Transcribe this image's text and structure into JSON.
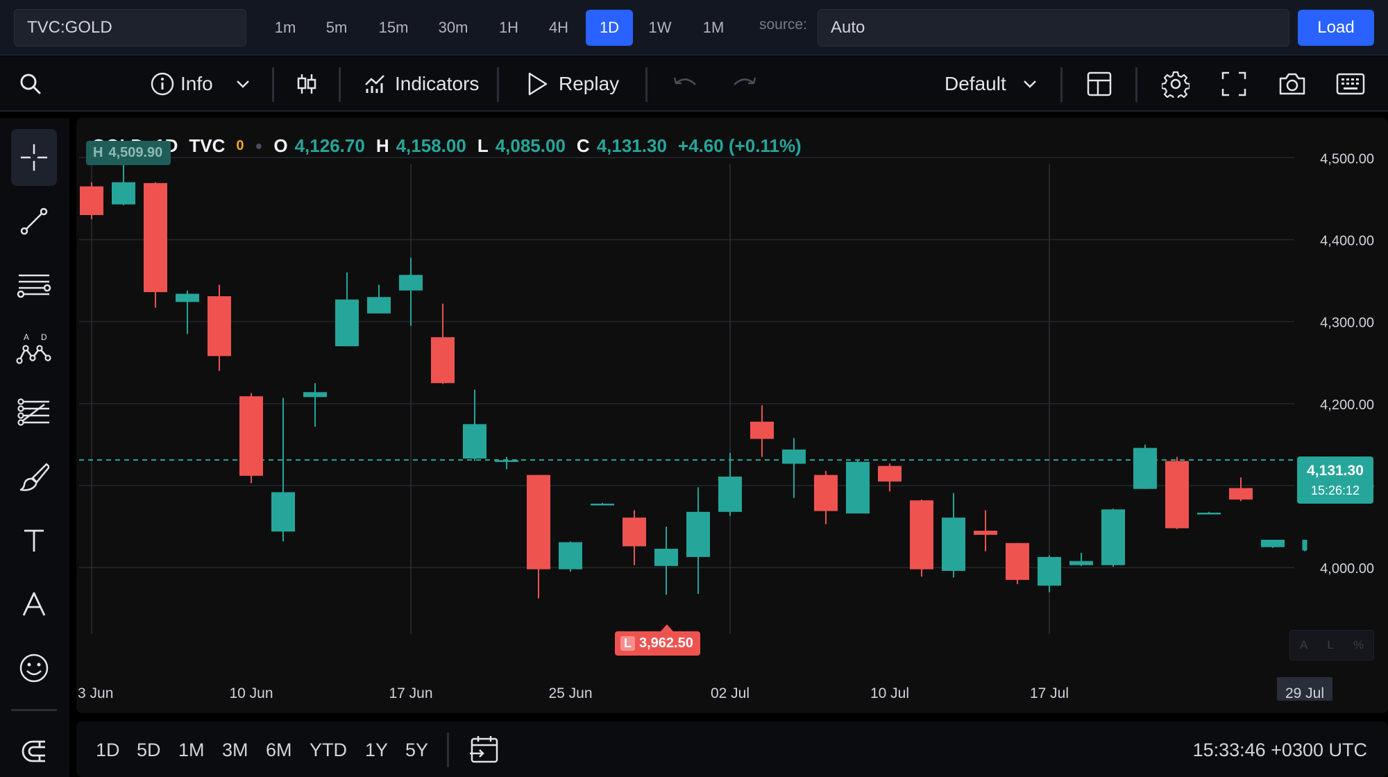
{
  "topbar": {
    "symbol": "TVC:GOLD",
    "timeframes": [
      "1m",
      "5m",
      "15m",
      "30m",
      "1H",
      "4H",
      "1D",
      "1W",
      "1M"
    ],
    "active_timeframe": "1D",
    "source_label": "source:",
    "source_value": "Auto",
    "load_label": "Load",
    "accent_color": "#2962ff"
  },
  "toolbar": {
    "info_label": "Info",
    "indicators_label": "Indicators",
    "replay_label": "Replay",
    "layout_label": "Default",
    "icons": [
      "search-icon",
      "info-icon",
      "chevron-down-icon",
      "candles-icon",
      "indicators-icon",
      "play-icon",
      "undo-icon",
      "redo-icon",
      "chevron-down-icon",
      "layout-icon",
      "gear-icon",
      "fullscreen-icon",
      "camera-icon",
      "keyboard-icon"
    ]
  },
  "left_toolbar": {
    "tools": [
      "crosshair-icon",
      "trend-line-icon",
      "horizontal-lines-icon",
      "pattern-icon",
      "fib-icon",
      "brush-icon",
      "text-icon",
      "font-icon",
      "emoji-icon",
      "magnet-icon"
    ],
    "pattern_letters": [
      "A",
      "D"
    ]
  },
  "legend": {
    "symbol": "GOLD",
    "interval": "1D",
    "exchange": "TVC",
    "zero": "0",
    "o_label": "O",
    "o_value": "4,126.70",
    "h_label": "H",
    "h_value": "4,158.00",
    "l_label": "L",
    "l_value": "4,085.00",
    "c_label": "C",
    "c_value": "4,131.30",
    "change": "+4.60 (+0.11%)"
  },
  "last_price_badge": {
    "price": "4,131.30",
    "countdown": "15:26:12"
  },
  "high_marker": {
    "letter": "H",
    "value": "4,509.90"
  },
  "low_marker": {
    "letter": "L",
    "value": "3,962.50"
  },
  "scale_buttons": [
    "A",
    "L",
    "%"
  ],
  "chart_data": {
    "type": "candlestick",
    "colors": {
      "up": "#26a69a",
      "down": "#ef5350",
      "grid": "#25272c",
      "text": "#d1d4dc"
    },
    "ylim": [
      3880,
      4540
    ],
    "y_ticks": [
      4000,
      4100,
      4200,
      4300,
      4400,
      4500
    ],
    "y_tick_labels": [
      "4,000.00",
      "4,100.00",
      "4,200.00",
      "4,300.00",
      "4,400.00",
      "4,500.00"
    ],
    "x_tick_labels": [
      "3 Jun",
      "10 Jun",
      "17 Jun",
      "25 Jun",
      "02 Jul",
      "10 Jul",
      "17 Jul",
      "29 Jul"
    ],
    "x_tick_indices": [
      0,
      5,
      10,
      15,
      20,
      25,
      30,
      38
    ],
    "vertical_grid_indices": [
      0,
      10,
      20,
      30
    ],
    "last_price": 4131.3,
    "candles": [
      {
        "o": 4465,
        "h": 4470,
        "l": 4425,
        "c": 4430
      },
      {
        "o": 4443,
        "h": 4509.9,
        "l": 4442,
        "c": 4470
      },
      {
        "o": 4469,
        "h": 4470,
        "l": 4317,
        "c": 4336
      },
      {
        "o": 4324,
        "h": 4338,
        "l": 4285,
        "c": 4334
      },
      {
        "o": 4331,
        "h": 4345,
        "l": 4240,
        "c": 4258
      },
      {
        "o": 4209,
        "h": 4213,
        "l": 4103,
        "c": 4112
      },
      {
        "o": 4044,
        "h": 4207,
        "l": 4032,
        "c": 4092
      },
      {
        "o": 4208,
        "h": 4225,
        "l": 4172,
        "c": 4214
      },
      {
        "o": 4270,
        "h": 4360,
        "l": 4270,
        "c": 4327
      },
      {
        "o": 4310,
        "h": 4345,
        "l": 4310,
        "c": 4330
      },
      {
        "o": 4338,
        "h": 4378,
        "l": 4295,
        "c": 4357
      },
      {
        "o": 4281,
        "h": 4322,
        "l": 4224,
        "c": 4225
      },
      {
        "o": 4133,
        "h": 4217,
        "l": 4130,
        "c": 4175
      },
      {
        "o": 4129,
        "h": 4135,
        "l": 4120,
        "c": 4131
      },
      {
        "o": 4113,
        "h": 4113,
        "l": 3962.5,
        "c": 3998
      },
      {
        "o": 3998,
        "h": 4032,
        "l": 3995,
        "c": 4031
      },
      {
        "o": 4078,
        "h": 4079,
        "l": 4077,
        "c": 4078
      },
      {
        "o": 4061,
        "h": 4070,
        "l": 4003,
        "c": 4026
      },
      {
        "o": 4002,
        "h": 4050,
        "l": 3967,
        "c": 4023
      },
      {
        "o": 4013,
        "h": 4098,
        "l": 3968,
        "c": 4068
      },
      {
        "o": 4068,
        "h": 4140,
        "l": 4063,
        "c": 4111
      },
      {
        "o": 4178,
        "h": 4198,
        "l": 4135,
        "c": 4157
      },
      {
        "o": 4126.7,
        "h": 4158,
        "l": 4085,
        "c": 4144
      },
      {
        "o": 4113,
        "h": 4118,
        "l": 4053,
        "c": 4069
      },
      {
        "o": 4066,
        "h": 4131,
        "l": 4066,
        "c": 4129
      },
      {
        "o": 4124,
        "h": 4127,
        "l": 4093,
        "c": 4105
      },
      {
        "o": 4082,
        "h": 4083,
        "l": 3989,
        "c": 3998
      },
      {
        "o": 3996,
        "h": 4091,
        "l": 3988,
        "c": 4061
      },
      {
        "o": 4045,
        "h": 4070,
        "l": 4020,
        "c": 4040
      },
      {
        "o": 4030,
        "h": 4030,
        "l": 3980,
        "c": 3985
      },
      {
        "o": 3978,
        "h": 4015,
        "l": 3970,
        "c": 4013
      },
      {
        "o": 4003,
        "h": 4018,
        "l": 4002,
        "c": 4008
      },
      {
        "o": 4003,
        "h": 4072,
        "l": 4001,
        "c": 4071
      },
      {
        "o": 4096,
        "h": 4150,
        "l": 4096,
        "c": 4146
      },
      {
        "o": 4130,
        "h": 4135,
        "l": 4047,
        "c": 4048
      },
      {
        "o": 4067,
        "h": 4068,
        "l": 4066,
        "c": 4067
      },
      {
        "o": 4097,
        "h": 4110,
        "l": 4081,
        "c": 4083
      },
      {
        "o": 4025,
        "h": 4034,
        "l": 4024,
        "c": 4034
      },
      {
        "o": 4021,
        "h": 4034,
        "l": 4020,
        "c": 4034
      }
    ]
  },
  "bottombar": {
    "ranges": [
      "1D",
      "5D",
      "1M",
      "3M",
      "6M",
      "YTD",
      "1Y",
      "5Y"
    ],
    "clock": "15:33:46 +0300 UTC"
  }
}
